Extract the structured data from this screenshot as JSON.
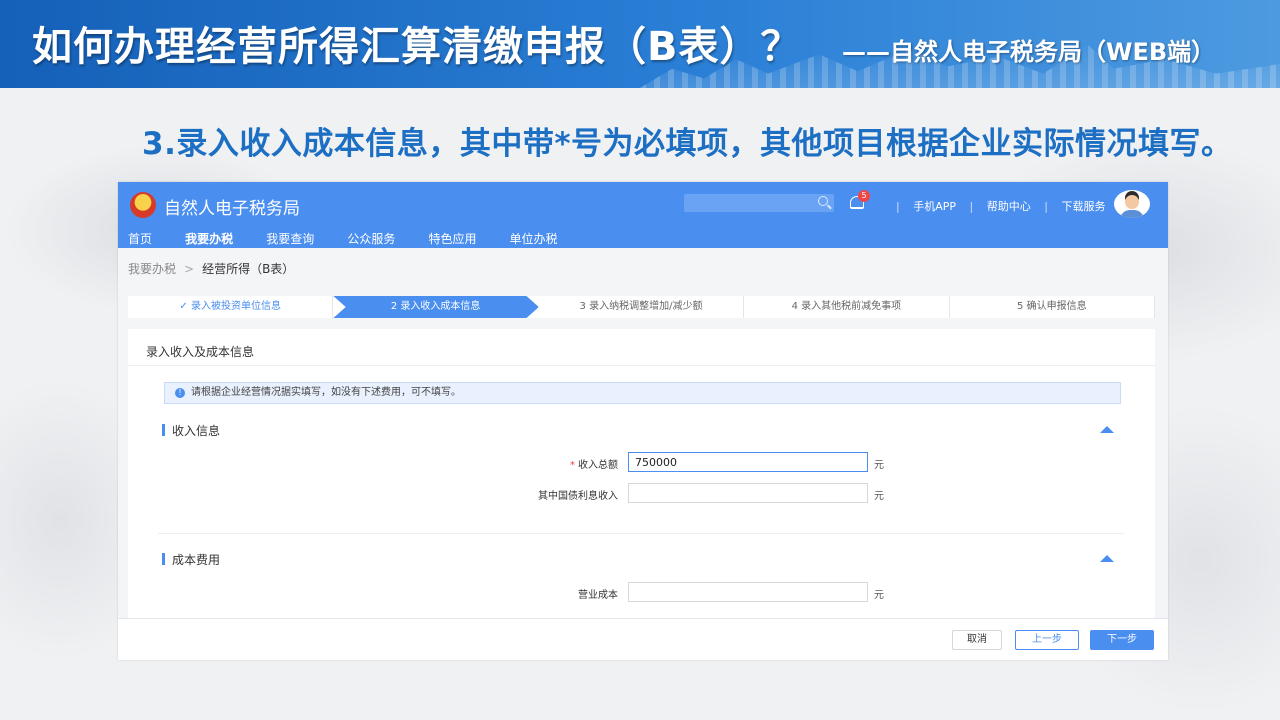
{
  "slide": {
    "title": "如何办理经营所得汇算清缴申报（B表）？",
    "subtitle": "——自然人电子税务局（WEB端）",
    "step_heading": "3.录入收入成本信息，其中带*号为必填项，其他项目根据企业实际情况填写。"
  },
  "app": {
    "logo_text": "自然人电子税务局",
    "notification_count": "5",
    "header_links": [
      "手机APP",
      "帮助中心",
      "下载服务"
    ],
    "nav": [
      "首页",
      "我要办税",
      "我要查询",
      "公众服务",
      "特色应用",
      "单位办税"
    ],
    "nav_active": "我要办税",
    "breadcrumb": {
      "parent": "我要办税",
      "current": "经营所得（B表）"
    },
    "steps": [
      {
        "label": "✓ 录入被投资单位信息",
        "state": "done"
      },
      {
        "label": "2 录入收入成本信息",
        "state": "active"
      },
      {
        "label": "3 录入纳税调整增加/减少额",
        "state": "pending"
      },
      {
        "label": "4 录入其他税前减免事项",
        "state": "pending"
      },
      {
        "label": "5 确认申报信息",
        "state": "pending"
      }
    ],
    "card_title": "录入收入及成本信息",
    "notice": "请根据企业经营情况据实填写，如没有下述费用，可不填写。",
    "income_section": {
      "title": "收入信息",
      "fields": [
        {
          "label": "收入总额",
          "required": "*",
          "value": "750000",
          "unit": "元"
        },
        {
          "label": "其中国债利息收入",
          "value": "",
          "unit": "元"
        }
      ]
    },
    "cost_section": {
      "title": "成本费用",
      "fields": [
        {
          "label": "营业成本",
          "value": "",
          "unit": "元"
        }
      ]
    },
    "buttons": {
      "cancel": "取消",
      "prev": "上一步",
      "next": "下一步"
    },
    "colors": {
      "primary": "#4a8ef0",
      "banner": "#1560b8",
      "heading": "#1d6fc4",
      "required": "#f04646"
    }
  }
}
